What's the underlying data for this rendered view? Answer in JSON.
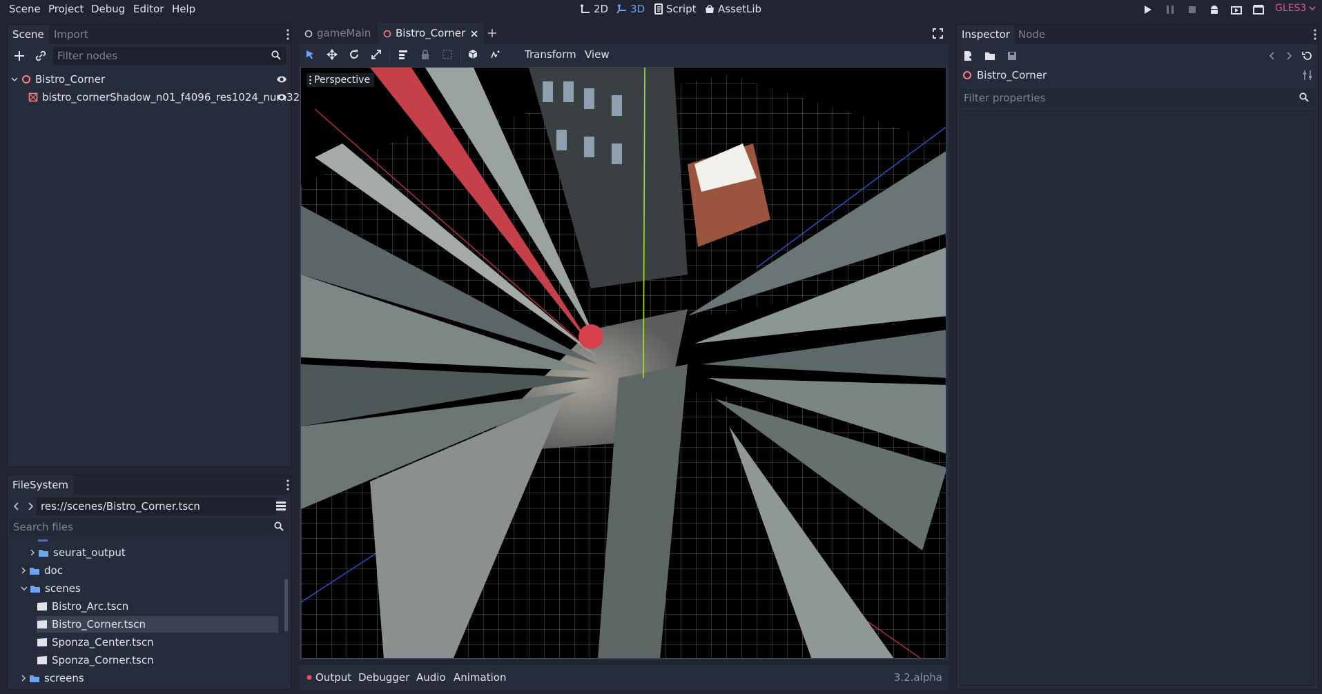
{
  "menu": [
    "Scene",
    "Project",
    "Debug",
    "Editor",
    "Help"
  ],
  "workspaces": [
    {
      "label": "2D",
      "icon": "2d-icon",
      "active": false
    },
    {
      "label": "3D",
      "icon": "3d-icon",
      "active": true
    },
    {
      "label": "Script",
      "icon": "script-icon",
      "active": false
    },
    {
      "label": "AssetLib",
      "icon": "assetlib-icon",
      "active": false
    }
  ],
  "renderer": "GLES3",
  "scene_dock": {
    "tabs": [
      "Scene",
      "Import"
    ],
    "filter_placeholder": "Filter nodes",
    "nodes": [
      "Bistro_Corner",
      "bistro_cornerShadow_n01_f4096_res1024_num32"
    ]
  },
  "filesystem": {
    "tab": "FileSystem",
    "path": "res://scenes/Bistro_Corner.tscn",
    "search_placeholder": "Search files",
    "items": [
      {
        "label": "seurat_output",
        "kind": "folder",
        "expanded": false
      },
      {
        "label": "doc",
        "kind": "folder",
        "expanded": false
      },
      {
        "label": "scenes",
        "kind": "folder",
        "expanded": true
      },
      {
        "label": "Bistro_Arc.tscn",
        "kind": "scene",
        "selected": false
      },
      {
        "label": "Bistro_Corner.tscn",
        "kind": "scene",
        "selected": true
      },
      {
        "label": "Sponza_Center.tscn",
        "kind": "scene",
        "selected": false
      },
      {
        "label": "Sponza_Corner.tscn",
        "kind": "scene",
        "selected": false
      },
      {
        "label": "screens",
        "kind": "folder",
        "expanded": false
      }
    ]
  },
  "editor_tabs": [
    {
      "label": "gameMain",
      "active": false
    },
    {
      "label": "Bistro_Corner",
      "active": true
    }
  ],
  "viewport_toolbar": {
    "transform": "Transform",
    "view": "View"
  },
  "viewport": {
    "label": "Perspective"
  },
  "bottom_panel": {
    "tabs": [
      "Output",
      "Debugger",
      "Audio",
      "Animation"
    ],
    "version": "3.2.alpha"
  },
  "inspector": {
    "tabs": [
      "Inspector",
      "Node"
    ],
    "object": "Bistro_Corner",
    "filter_placeholder": "Filter properties"
  },
  "colors": {
    "accent": "#6ea5f2",
    "node_ring": "#fc7f7f",
    "renderer": "#d95a95",
    "output_dot": "#e0525c"
  }
}
